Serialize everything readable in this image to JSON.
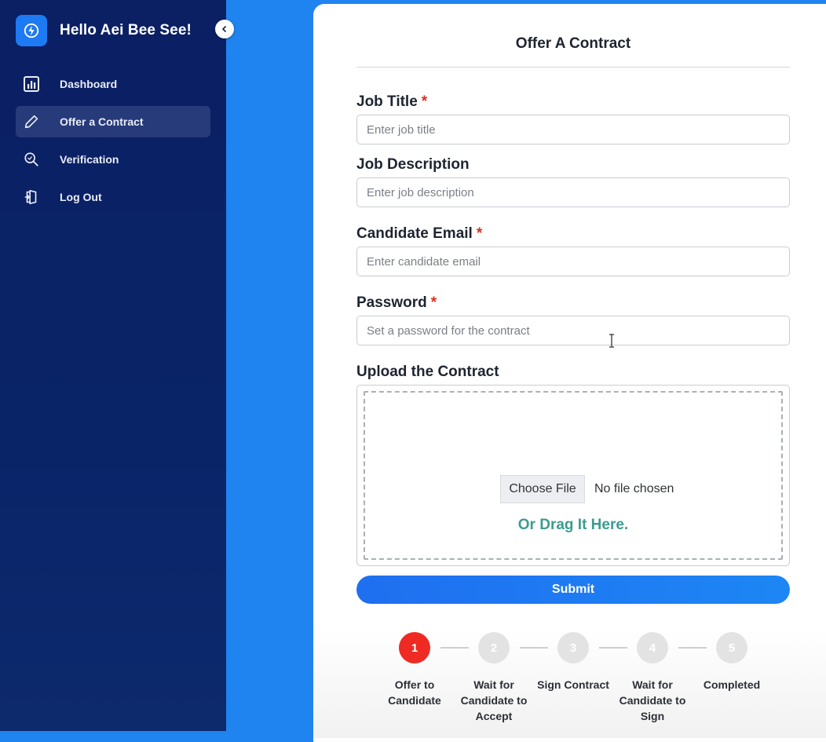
{
  "sidebar": {
    "greeting": "Hello Aei Bee See!",
    "items": [
      {
        "label": "Dashboard",
        "icon": "bar-chart-icon"
      },
      {
        "label": "Offer a Contract",
        "icon": "pencil-icon",
        "active": true
      },
      {
        "label": "Verification",
        "icon": "search-icon"
      },
      {
        "label": "Log Out",
        "icon": "logout-icon"
      }
    ]
  },
  "form": {
    "title": "Offer A Contract",
    "job_title": {
      "label": "Job Title",
      "required_mark": "*",
      "placeholder": "Enter job title",
      "value": ""
    },
    "job_description": {
      "label": "Job Description",
      "placeholder": "Enter job description",
      "value": ""
    },
    "candidate_email": {
      "label": "Candidate Email",
      "required_mark": "*",
      "placeholder": "Enter candidate email",
      "value": ""
    },
    "password": {
      "label": "Password",
      "required_mark": "*",
      "placeholder": "Set a password for the contract",
      "value": ""
    },
    "upload": {
      "label": "Upload the Contract",
      "choose_file": "Choose File",
      "file_status": "No file chosen",
      "drag_text": "Or Drag It Here."
    },
    "submit_label": "Submit"
  },
  "steps": [
    {
      "number": "1",
      "label": "Offer to Candidate",
      "active": true
    },
    {
      "number": "2",
      "label": "Wait for Candidate to Accept",
      "active": false
    },
    {
      "number": "3",
      "label": "Sign Contract",
      "active": false
    },
    {
      "number": "4",
      "label": "Wait for Candidate to Sign",
      "active": false
    },
    {
      "number": "5",
      "label": "Completed",
      "active": false
    }
  ],
  "colors": {
    "sidebar_bg": "#0b1f63",
    "accent": "#1f6ff0",
    "active_step": "#ee2a22",
    "required": "#e02b20",
    "drag_text": "#3d9b8f"
  }
}
